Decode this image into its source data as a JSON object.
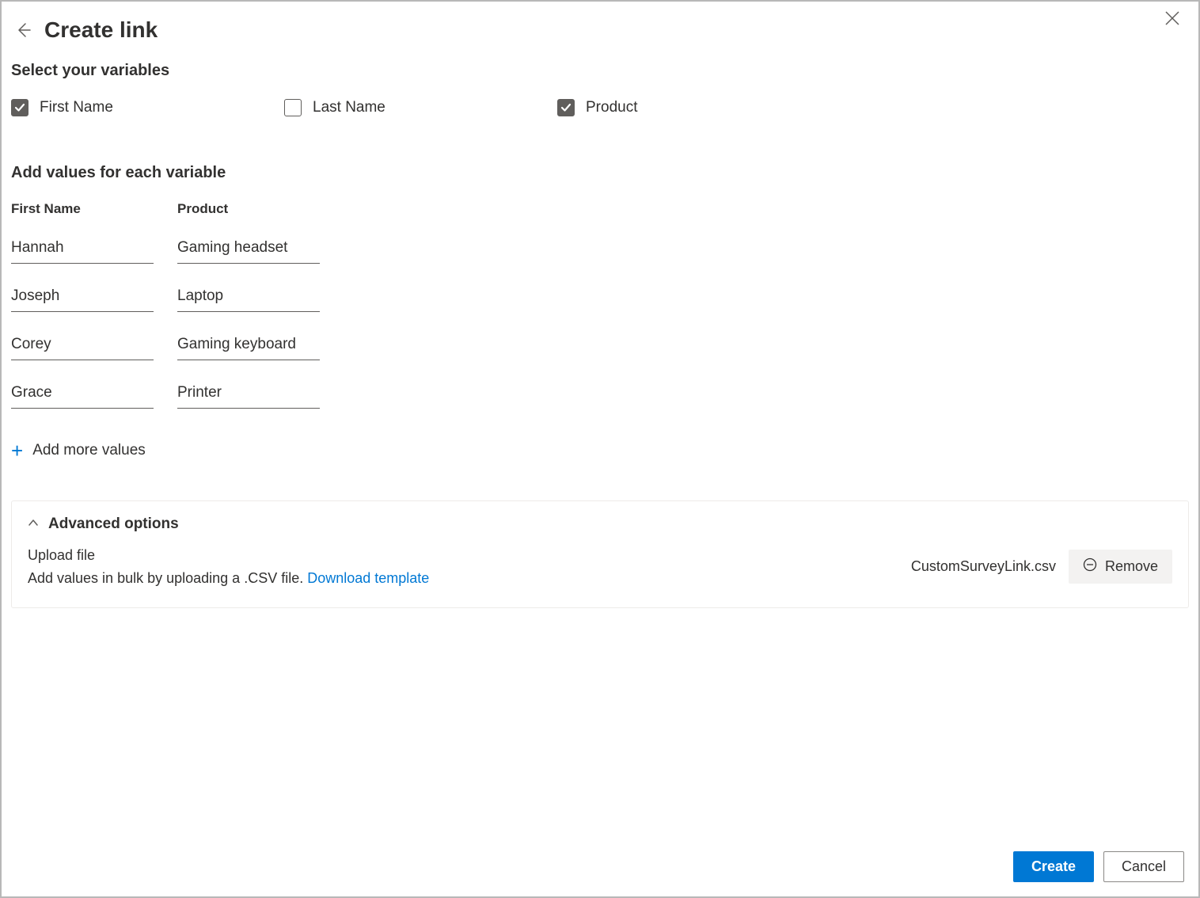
{
  "header": {
    "title": "Create link"
  },
  "sections": {
    "selectVariables": "Select your variables",
    "addValues": "Add values for each variable"
  },
  "variables": [
    {
      "label": "First Name",
      "checked": true
    },
    {
      "label": "Last Name",
      "checked": false
    },
    {
      "label": "Product",
      "checked": true
    }
  ],
  "table": {
    "headers": [
      "First Name",
      "Product"
    ],
    "rows": [
      {
        "firstName": "Hannah",
        "product": "Gaming headset"
      },
      {
        "firstName": "Joseph",
        "product": "Laptop"
      },
      {
        "firstName": "Corey",
        "product": "Gaming keyboard"
      },
      {
        "firstName": "Grace",
        "product": "Printer"
      }
    ]
  },
  "addMore": "Add more values",
  "advanced": {
    "title": "Advanced options",
    "uploadLabel": "Upload file",
    "uploadDescription": "Add values in bulk by uploading a .CSV file. ",
    "downloadLink": "Download template",
    "fileName": "CustomSurveyLink.csv",
    "removeLabel": "Remove"
  },
  "buttons": {
    "create": "Create",
    "cancel": "Cancel"
  }
}
